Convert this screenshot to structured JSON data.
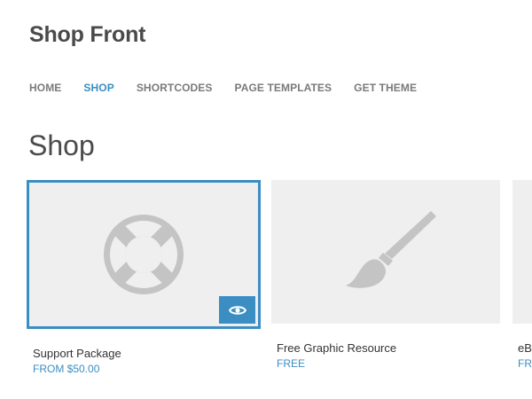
{
  "site": {
    "title": "Shop Front"
  },
  "nav": {
    "items": [
      {
        "label": "HOME"
      },
      {
        "label": "SHOP"
      },
      {
        "label": "SHORTCODES"
      },
      {
        "label": "PAGE TEMPLATES"
      },
      {
        "label": "GET THEME"
      }
    ],
    "active": "SHOP"
  },
  "main": {
    "page_title": "Shop"
  },
  "products": [
    {
      "name": "Support Package",
      "price": "FROM $50.00",
      "icon": "lifebuoy-icon"
    },
    {
      "name": "Free Graphic Resource",
      "price": "FREE",
      "icon": "paintbrush-icon"
    },
    {
      "name": "eBo",
      "price": "FR",
      "icon": ""
    }
  ],
  "colors": {
    "accent": "#3b8ec2",
    "text": "#4a4a4a",
    "placeholder_bg": "#efefef",
    "placeholder_icon": "#c4c4c4"
  }
}
